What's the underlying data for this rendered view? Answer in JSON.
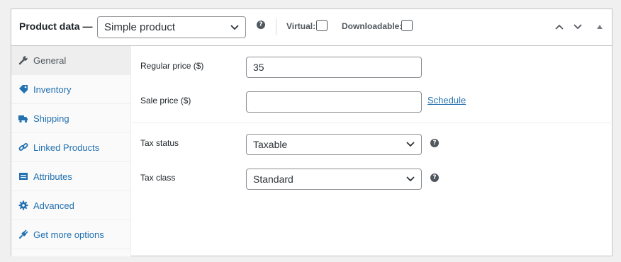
{
  "header": {
    "title": "Product data —",
    "product_type": "Simple product",
    "virtual_label": "Virtual:",
    "downloadable_label": "Downloadable:",
    "help_glyph": "?"
  },
  "tabs": [
    {
      "label": "General",
      "icon": "wrench-icon",
      "active": true
    },
    {
      "label": "Inventory",
      "icon": "tag-icon",
      "active": false
    },
    {
      "label": "Shipping",
      "icon": "truck-icon",
      "active": false
    },
    {
      "label": "Linked Products",
      "icon": "link-icon",
      "active": false
    },
    {
      "label": "Attributes",
      "icon": "list-icon",
      "active": false
    },
    {
      "label": "Advanced",
      "icon": "gear-icon",
      "active": false
    },
    {
      "label": "Get more options",
      "icon": "plugin-icon",
      "active": false
    }
  ],
  "general": {
    "regular_price_label": "Regular price ($)",
    "regular_price_value": "35",
    "sale_price_label": "Sale price ($)",
    "sale_price_value": "",
    "schedule_link": "Schedule",
    "tax_status_label": "Tax status",
    "tax_status_value": "Taxable",
    "tax_class_label": "Tax class",
    "tax_class_value": "Standard"
  },
  "colors": {
    "link": "#2271b1",
    "text": "#1d2327",
    "border": "#c3c4c7"
  }
}
